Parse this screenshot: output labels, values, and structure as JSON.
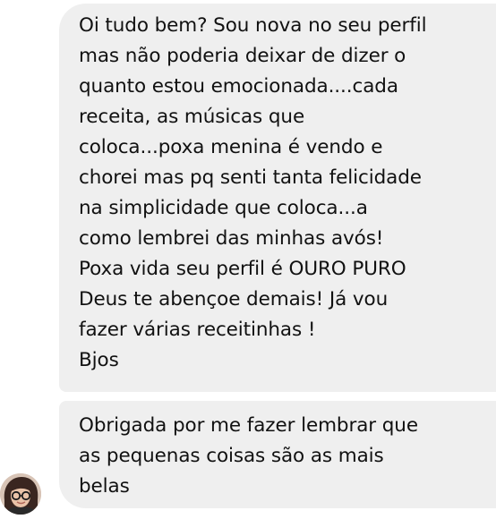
{
  "conversation": {
    "messages": [
      {
        "sender": "other",
        "lines": [
          "Oi tudo bem? Sou nova no seu perfil",
          "mas não poderia deixar de dizer o",
          "quanto estou emocionada....cada",
          "receita, as músicas que",
          "coloca...poxa menina é vendo e",
          "chorei mas pq senti tanta felicidade",
          "na simplicidade que coloca...a",
          "como lembrei das minhas avós!",
          "Poxa vida seu perfil é OURO PURO",
          "Deus te abençoe demais! Já vou",
          "fazer várias receitinhas !",
          "Bjos"
        ]
      },
      {
        "sender": "other",
        "lines": [
          "Obrigada por me fazer lembrar que",
          "as pequenas coisas são as mais",
          "belas"
        ]
      }
    ],
    "bubble_color": "#efefef",
    "text_color": "#111111",
    "avatar_icon": "user-avatar-icon"
  }
}
